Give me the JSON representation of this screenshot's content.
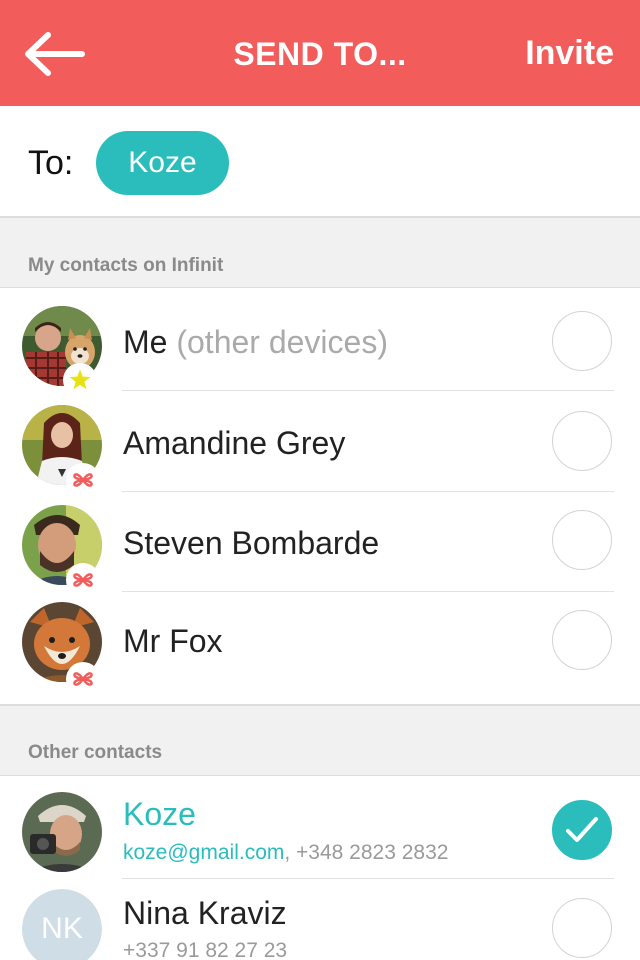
{
  "header": {
    "title": "SEND TO...",
    "invite_label": "Invite",
    "back_icon": "arrow-left-icon",
    "background": "#f25d5c"
  },
  "recipients": {
    "label": "To:",
    "chips": [
      "Koze"
    ]
  },
  "sections": {
    "infinit": {
      "label": "My contacts on Infinit"
    },
    "other": {
      "label": "Other contacts"
    }
  },
  "infinit_contacts": [
    {
      "name": "Me",
      "suffix": " (other devices)",
      "badge": "star-icon",
      "selected": false
    },
    {
      "name": "Amandine Grey",
      "badge": "infinit-logo-icon",
      "selected": false
    },
    {
      "name": "Steven Bombarde",
      "badge": "infinit-logo-icon",
      "selected": false
    },
    {
      "name": "Mr Fox",
      "badge": "infinit-logo-icon",
      "selected": false
    }
  ],
  "other_contacts": [
    {
      "name": "Koze",
      "email": "koze@gmail.com",
      "separator": ", ",
      "phone": "+348 2823 2832",
      "selected": true
    },
    {
      "name": "Nina Kraviz",
      "initials": "NK",
      "phone": "+337 91 82 27 23",
      "selected": false
    }
  ],
  "colors": {
    "accent": "#2bbdbc",
    "brand": "#f25d5c",
    "star": "#e8e215"
  }
}
